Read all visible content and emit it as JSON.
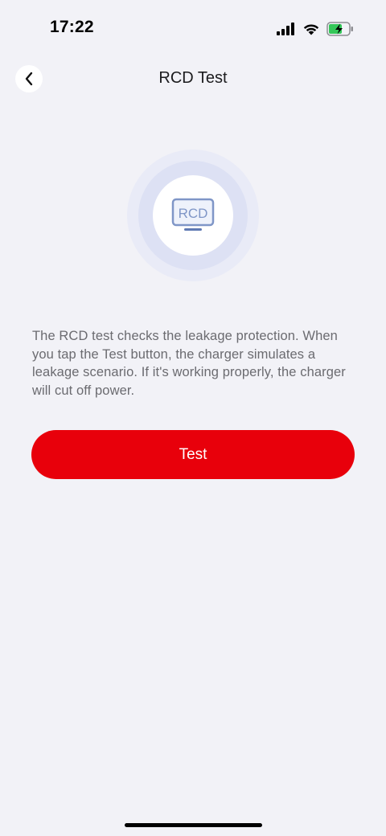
{
  "status_bar": {
    "time": "17:22",
    "icons": [
      "cellular-signal-icon",
      "wifi-icon",
      "battery-charging-icon"
    ]
  },
  "nav": {
    "title": "RCD Test",
    "back_icon": "chevron-left-icon"
  },
  "hero": {
    "icon": "rcd-device-icon",
    "icon_label": "RCD",
    "accent_color": "#7f96c7"
  },
  "description": "The RCD test checks the leakage protection. When you tap the Test button, the charger simulates a leakage scenario. If it's working properly, the charger will cut off power.",
  "actions": {
    "test_label": "Test",
    "test_color": "#e8000b"
  }
}
